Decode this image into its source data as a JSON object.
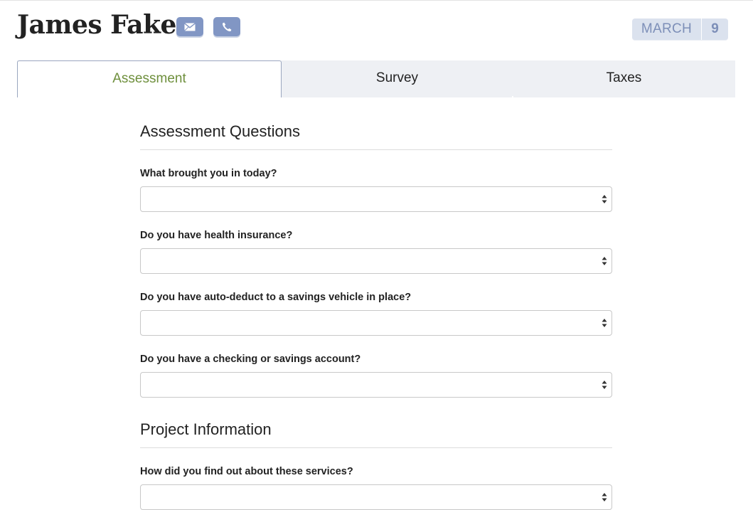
{
  "header": {
    "name": "James Fake",
    "icons": [
      "mail-icon",
      "phone-icon"
    ],
    "date": {
      "month": "MARCH",
      "day": "9"
    }
  },
  "tabs": [
    {
      "label": "Assessment",
      "active": true
    },
    {
      "label": "Survey",
      "active": false
    },
    {
      "label": "Taxes",
      "active": false
    }
  ],
  "sections": [
    {
      "title": "Assessment Questions",
      "questions": [
        {
          "label": "What brought you in today?",
          "value": ""
        },
        {
          "label": "Do you have health insurance?",
          "value": ""
        },
        {
          "label": "Do you have auto-deduct to a savings vehicle in place?",
          "value": ""
        },
        {
          "label": "Do you have a checking or savings account?",
          "value": ""
        }
      ]
    },
    {
      "title": "Project Information",
      "questions": [
        {
          "label": "How did you find out about these services?",
          "value": ""
        }
      ]
    }
  ],
  "colors": {
    "accent_icon": "#8196c4",
    "active_tab_text": "#6e8f3c",
    "date_badge_bg": "#dbe2ee",
    "date_badge_text": "#7d8fb8",
    "tab_bar_bg": "#eef0f4"
  }
}
